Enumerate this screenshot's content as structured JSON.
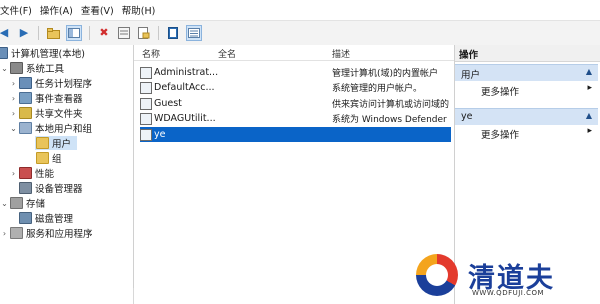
{
  "menu": [
    "文件(F)",
    "操作(A)",
    "查看(V)",
    "帮助(H)"
  ],
  "toolbar": {
    "icons": [
      "back-arrow-icon",
      "forward-arrow-icon",
      "up-folder-icon",
      "show-tree-icon",
      "delete-icon",
      "properties-icon",
      "export-icon",
      "help-icon",
      "console-tree-icon"
    ]
  },
  "tree": {
    "root": "计算机管理(本地)",
    "system_tools": "系统工具",
    "task_scheduler": "任务计划程序",
    "event_viewer": "事件查看器",
    "shared_folders": "共享文件夹",
    "local_users_groups": "本地用户和组",
    "users": "用户",
    "groups": "组",
    "performance": "性能",
    "device_manager": "设备管理器",
    "storage": "存储",
    "disk_management": "磁盘管理",
    "services_apps": "服务和应用程序"
  },
  "list": {
    "col_name": "名称",
    "col_fullname": "全名",
    "col_desc": "描述",
    "rows": [
      {
        "name": "Administrat...",
        "desc": "管理计算机(域)的内置帐户"
      },
      {
        "name": "DefaultAcc...",
        "desc": "系统管理的用户帐户。"
      },
      {
        "name": "Guest",
        "desc": "供来宾访问计算机或访问域的"
      },
      {
        "name": "WDAGUtilit...",
        "desc": "系统为 Windows Defender"
      },
      {
        "name": "ye",
        "desc": ""
      }
    ]
  },
  "actions": {
    "title": "操作",
    "sections": [
      {
        "label": "用户",
        "item": "更多操作"
      },
      {
        "label": "ye",
        "item": "更多操作"
      }
    ]
  },
  "watermark": {
    "brand": "清道夫",
    "url": "WWW.QDFUJI.COM"
  }
}
